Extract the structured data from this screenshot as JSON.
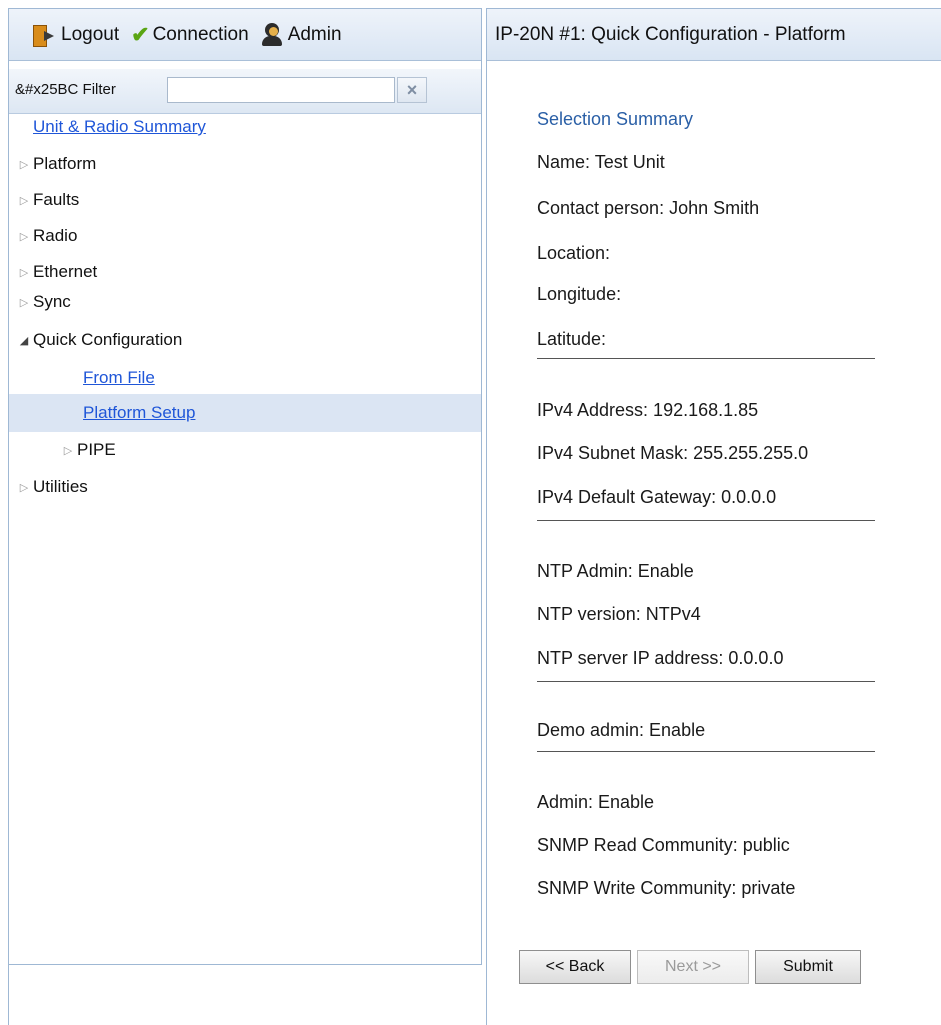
{
  "toolbar": {
    "logout_label": "Logout",
    "connection_label": "Connection",
    "admin_label": "Admin"
  },
  "filter": {
    "label": "&#x25BC Filter",
    "value": "",
    "clear_glyph": "×"
  },
  "nav": {
    "items": [
      {
        "label": "Unit & Radio Summary",
        "type": "link"
      },
      {
        "label": "Platform",
        "type": "collapsed"
      },
      {
        "label": "Faults",
        "type": "collapsed"
      },
      {
        "label": "Radio",
        "type": "collapsed"
      },
      {
        "label": "Ethernet",
        "type": "collapsed"
      },
      {
        "label": "Sync",
        "type": "collapsed"
      },
      {
        "label": "Quick Configuration",
        "type": "expanded"
      },
      {
        "label": "From File",
        "type": "link"
      },
      {
        "label": "Platform Setup",
        "type": "link",
        "selected": true
      },
      {
        "label": "PIPE",
        "type": "collapsed"
      },
      {
        "label": "Utilities",
        "type": "collapsed"
      }
    ]
  },
  "page": {
    "title": "IP-20N #1: Quick Configuration - Platform",
    "section_title": "Selection Summary",
    "fields": [
      "Name: Test Unit",
      "Contact person: John Smith",
      "Location:",
      "Longitude:",
      "Latitude:",
      "IPv4 Address: 192.168.1.85",
      "IPv4 Subnet Mask: 255.255.255.0",
      "IPv4 Default Gateway: 0.0.0.0",
      "NTP Admin: Enable",
      "NTP version: NTPv4",
      "NTP server IP address: 0.0.0.0",
      "Demo admin: Enable",
      "Admin: Enable",
      "SNMP Read Community: public",
      "SNMP Write Community: private"
    ]
  },
  "buttons": {
    "back": "<< Back",
    "next": "Next >>",
    "submit": "Submit"
  },
  "colors": {
    "link": "#1f56d8",
    "section_title": "#2a5fa6",
    "selected_row": "#dbe5f3",
    "panel_border": "#9fb8d4"
  },
  "icons": [
    "logout-icon",
    "check-icon",
    "admin-icon",
    "clear-icon",
    "expand-triangle-icon",
    "collapse-triangle-icon"
  ]
}
